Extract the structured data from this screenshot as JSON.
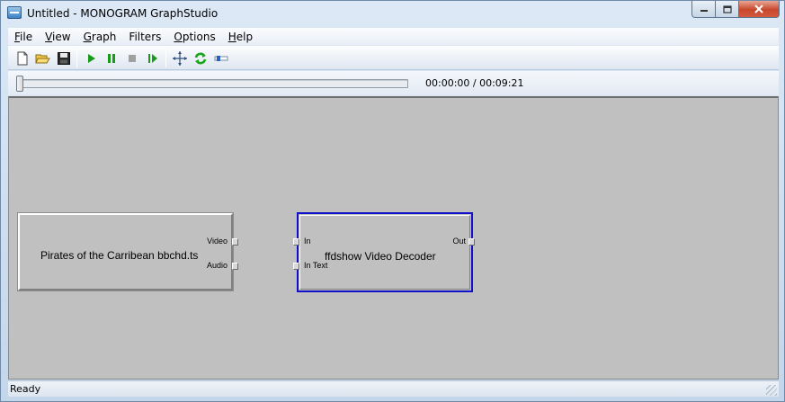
{
  "window": {
    "title": "Untitled - MONOGRAM GraphStudio"
  },
  "menu": [
    {
      "key": "F",
      "rest": "ile"
    },
    {
      "key": "V",
      "rest": "iew"
    },
    {
      "key": "G",
      "rest": "raph"
    },
    {
      "key": "F",
      "rest": "ilters"
    },
    {
      "key": "O",
      "rest": "ptions"
    },
    {
      "key": "H",
      "rest": "elp"
    }
  ],
  "toolbar": {
    "icons": [
      "new-file-icon",
      "open-folder-icon",
      "save-icon",
      "play-icon",
      "pause-icon",
      "stop-icon",
      "step-icon",
      "arrange-icon",
      "refresh-icon",
      "slider-icon"
    ]
  },
  "seek": {
    "time": "00:00:00 / 00:09:21",
    "position": 0.0
  },
  "graph": {
    "filters": [
      {
        "name": "Pirates of the Carribean bbchd.ts",
        "output_pins": [
          "Video",
          "Audio"
        ]
      },
      {
        "name": "ffdshow Video Decoder",
        "input_pins": [
          "In",
          "In Text"
        ],
        "output_pins": [
          "Out"
        ],
        "selected": true
      }
    ],
    "selection_color": "#1010c8"
  },
  "status": {
    "text": "Ready"
  }
}
